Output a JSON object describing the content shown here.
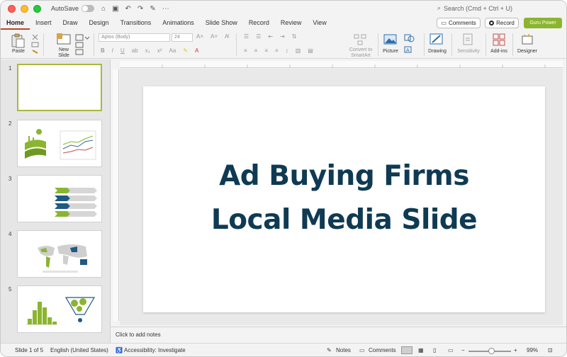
{
  "titlebar": {
    "autosave_label": "AutoSave",
    "search_placeholder": "Search (Cmd + Ctrl + U)"
  },
  "tabs": [
    "Home",
    "Insert",
    "Draw",
    "Design",
    "Transitions",
    "Animations",
    "Slide Show",
    "Record",
    "Review",
    "View"
  ],
  "active_tab": "Home",
  "header_buttons": {
    "comments": "Comments",
    "record": "Record",
    "guru": "Guru Power"
  },
  "ribbon": {
    "paste": "Paste",
    "new_slide": "New Slide",
    "font_name": "Aptos (Body)",
    "font_size": "24",
    "convert_smartart": "Convert to SmartArt",
    "picture": "Picture",
    "drawing": "Drawing",
    "sensitivity": "Sensitivity",
    "addins": "Add-ins",
    "designer": "Designer"
  },
  "thumbnails": [
    {
      "number": "1",
      "kind": "blank",
      "selected": true
    },
    {
      "number": "2",
      "kind": "chart"
    },
    {
      "number": "3",
      "kind": "arrows"
    },
    {
      "number": "4",
      "kind": "map"
    },
    {
      "number": "5",
      "kind": "histogram"
    }
  ],
  "slide": {
    "title_line1": "Ad Buying Firms",
    "title_line2": "Local Media Slide"
  },
  "notes_placeholder": "Click to add notes",
  "status": {
    "slide_of": "Slide 1 of 5",
    "language": "English (United States)",
    "accessibility": "Accessibility: Investigate",
    "notes": "Notes",
    "comments": "Comments",
    "zoom": "99%"
  },
  "colors": {
    "title": "#0f3a53",
    "accent_green": "#8bb52f",
    "accent_blue": "#1f5a80",
    "tab_underline": "#b7472a"
  }
}
